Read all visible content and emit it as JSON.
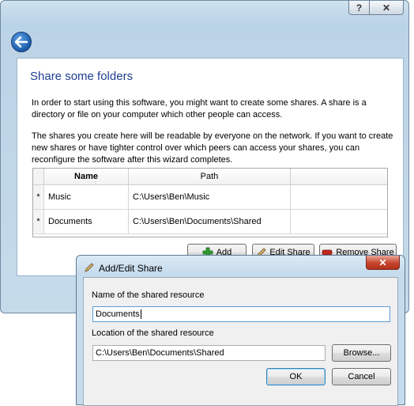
{
  "wizard": {
    "title": "Share some folders",
    "intro": "In order to start using this software, you might want to create some shares. A share is a directory or file on your computer which other people can access.",
    "note": "The shares you create here will be readable by everyone on the network. If you want to create new shares or have tighter control over which peers can access your shares, you can reconfigure the software after this wizard completes.",
    "help_label": "?",
    "close_label": "✕",
    "back_icon": "back-arrow-icon"
  },
  "shares_table": {
    "columns": [
      "Name",
      "Path"
    ],
    "rows": [
      {
        "marker": "*",
        "name": "Music",
        "path": "C:\\Users\\Ben\\Music"
      },
      {
        "marker": "*",
        "name": "Documents",
        "path": "C:\\Users\\Ben\\Documents\\Shared"
      }
    ]
  },
  "actions": {
    "add_label": "Add",
    "edit_label": "Edit Share",
    "remove_label": "Remove Share"
  },
  "dialog": {
    "title": "Add/Edit Share",
    "close_label": "✕",
    "name_label": "Name of the shared resource",
    "name_value": "Documents",
    "location_label": "Location of the shared resource",
    "location_value": "C:\\Users\\Ben\\Documents\\Shared",
    "browse_label": "Browse...",
    "ok_label": "OK",
    "cancel_label": "Cancel"
  },
  "colors": {
    "title_blue": "#1f3f93",
    "close_red": "#c7452c",
    "add_green": "#2f9a2f",
    "remove_red": "#c0281d"
  }
}
